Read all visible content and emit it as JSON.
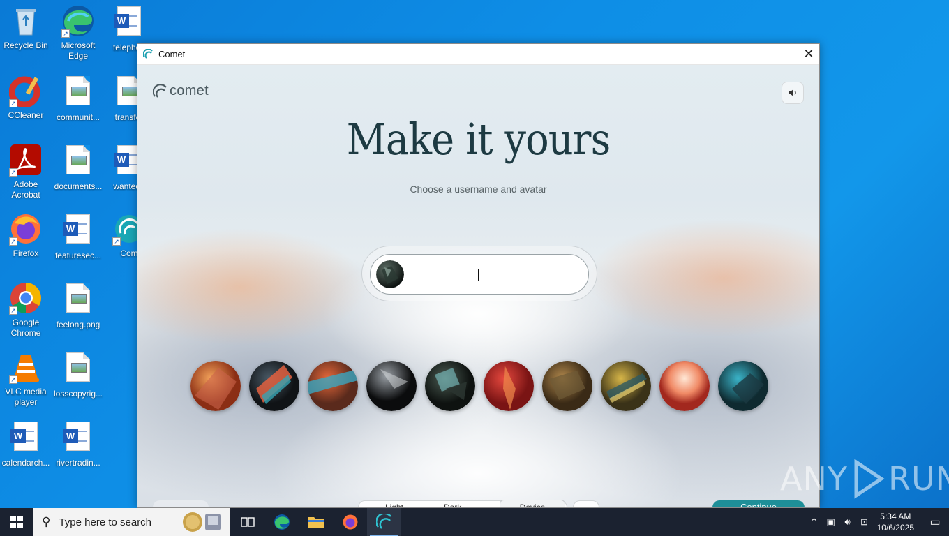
{
  "desktop": {
    "icons": [
      {
        "label": "Recycle Bin"
      },
      {
        "label": "Microsoft Edge"
      },
      {
        "label": "telephon"
      },
      {
        "label": "CCleaner"
      },
      {
        "label": "communit..."
      },
      {
        "label": "transfer"
      },
      {
        "label": "Adobe Acrobat"
      },
      {
        "label": "documents..."
      },
      {
        "label": "wanteda"
      },
      {
        "label": "Firefox"
      },
      {
        "label": "featuresec..."
      },
      {
        "label": "Com"
      },
      {
        "label": "Google Chrome"
      },
      {
        "label": "feelong.png"
      },
      {
        "label": "VLC media player"
      },
      {
        "label": "losscopyrig..."
      },
      {
        "label": "calendarch..."
      },
      {
        "label": "rivertradin..."
      }
    ]
  },
  "window": {
    "title": "Comet",
    "close_symbol": "✕"
  },
  "onboarding": {
    "brand": "comet",
    "headline": "Make it yours",
    "subtitle": "Choose a username and avatar",
    "username_value": "",
    "sound_icon": "speaker-icon",
    "avatar_count": 10,
    "bottom_controls": [
      "Light",
      "Dark",
      "Device"
    ],
    "continue_label": "Continue"
  },
  "taskbar": {
    "search_placeholder": "Type here to search",
    "clock_time": "5:34 AM",
    "clock_date": "10/6/2025"
  },
  "watermark": {
    "left": "ANY",
    "right": "RUN"
  }
}
